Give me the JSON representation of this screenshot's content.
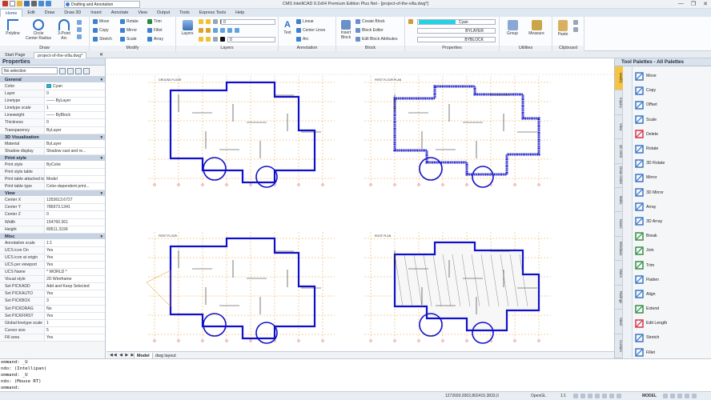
{
  "title_bar": {
    "workspace": "Drafting and Annotation",
    "title": "CMS IntelliCAD 9.2x64 Premium Edition Plus Net - [project-of-the-villa.dwg*]",
    "window_buttons": [
      "—",
      "❐",
      "✕"
    ]
  },
  "menu": [
    "Home",
    "Edit",
    "Draw",
    "Draw 3D",
    "Insert",
    "Annotate",
    "View",
    "Output",
    "Tools",
    "Express Tools",
    "Help"
  ],
  "ribbon": {
    "groups": [
      {
        "name": "Draw"
      },
      {
        "name": "Modify"
      },
      {
        "name": "Layers"
      },
      {
        "name": "Annotation"
      },
      {
        "name": "Block"
      },
      {
        "name": "Properties"
      },
      {
        "name": "Utilities"
      },
      {
        "name": "Clipboard"
      }
    ],
    "draw": {
      "polyline": "Polyline",
      "circle": "Circle",
      "circle_sub": "Center Radius",
      "arc": "3-Point",
      "arc_sub": "Arc"
    },
    "modify": {
      "move": "Move",
      "rotate": "Rotate",
      "trim": "Trim",
      "copy": "Copy",
      "mirror": "Mirror",
      "fillet": "Fillet",
      "stretch": "Stretch",
      "scale": "Scale",
      "array": "Array"
    },
    "layers": {
      "layers_btn": "Layers",
      "current_layer": "0",
      "layer2": "0"
    },
    "annotation": {
      "text": "Text",
      "linear": "Linear",
      "centerlines": "Center Lines",
      "arc": "Arc"
    },
    "block": {
      "insert": "Insert",
      "insert_sub": "Block",
      "create": "Create Block",
      "editor": "Block Editor",
      "edit_attrs": "Edit Block Attributes"
    },
    "properties": {
      "color": "Cyan",
      "linetype": "BYLAYER",
      "lineweight": "BYBLOCK"
    },
    "utilities": {
      "group": "Group",
      "measure": "Measure"
    },
    "clipboard": {
      "paste": "Paste"
    }
  },
  "doc_tabs": [
    "Start Page",
    "project-of-the-villa.dwg*"
  ],
  "properties_panel": {
    "title": "Properties",
    "selection": "No selection",
    "sections": [
      {
        "name": "General",
        "rows": [
          {
            "k": "Color",
            "v": "Cyan"
          },
          {
            "k": "Layer",
            "v": "0"
          },
          {
            "k": "Linetype",
            "v": "—— ByLayer"
          },
          {
            "k": "Linetype scale",
            "v": "1"
          },
          {
            "k": "Lineweight",
            "v": "—— ByBlock"
          },
          {
            "k": "Thickness",
            "v": "0"
          },
          {
            "k": "Transparency",
            "v": "ByLayer"
          }
        ]
      },
      {
        "name": "3D Visualization",
        "rows": [
          {
            "k": "Material",
            "v": "ByLayer"
          },
          {
            "k": "Shadow display",
            "v": "Shadow cast and re..."
          }
        ]
      },
      {
        "name": "Print style",
        "rows": [
          {
            "k": "Print style",
            "v": "ByColor"
          },
          {
            "k": "Print style table",
            "v": ""
          },
          {
            "k": "Print table attached to",
            "v": "Model"
          },
          {
            "k": "Print table type",
            "v": "Color-dependent print..."
          }
        ]
      },
      {
        "name": "View",
        "rows": [
          {
            "k": "Center X",
            "v": "1253613.6727"
          },
          {
            "k": "Center Y",
            "v": "786973.1341"
          },
          {
            "k": "Center Z",
            "v": "0"
          },
          {
            "k": "Width",
            "v": "154760.361"
          },
          {
            "k": "Height",
            "v": "89511.3199"
          }
        ]
      },
      {
        "name": "Misc",
        "rows": [
          {
            "k": "Annotation scale",
            "v": "1:1"
          },
          {
            "k": "UCS icon On",
            "v": "Yes"
          },
          {
            "k": "UCS icon at origin",
            "v": "Yes"
          },
          {
            "k": "UCS per viewport",
            "v": "Yes"
          },
          {
            "k": "UCS Name",
            "v": "* WORLD *"
          },
          {
            "k": "Visual style",
            "v": "2D Wireframe"
          },
          {
            "k": "Set PICKADD",
            "v": "Add and Keep Selected"
          },
          {
            "k": "Set PICKAUTO",
            "v": "Yes"
          },
          {
            "k": "Set PICKBOX",
            "v": "3"
          },
          {
            "k": "Set PICKDRAG",
            "v": "No"
          },
          {
            "k": "Set PICKFIRST",
            "v": "Yes"
          },
          {
            "k": "Global linetype scale",
            "v": "1"
          },
          {
            "k": "Cursor size",
            "v": "5"
          },
          {
            "k": "Fill area",
            "v": "Yes"
          }
        ]
      }
    ]
  },
  "canvas_tabs": {
    "model": "Model",
    "layout": "dwg layout"
  },
  "tool_palette": {
    "title": "Tool Palettes - All Palettes",
    "vertical_tabs": [
      "Modify",
      "Inquiry",
      "View",
      "3D Orbit",
      "Draw Order",
      "Walls",
      "Doors",
      "Windows",
      "Stairs",
      "Railings",
      "Steel",
      "Custom"
    ],
    "items": [
      {
        "label": "Move",
        "icon": "move-icon",
        "color": "#2f6fc4"
      },
      {
        "label": "Copy",
        "icon": "copy-icon",
        "color": "#2f6fc4"
      },
      {
        "label": "Offset",
        "icon": "offset-icon",
        "color": "#2f6fc4"
      },
      {
        "label": "Scale",
        "icon": "scale-icon",
        "color": "#2f6fc4"
      },
      {
        "label": "Delete",
        "icon": "delete-icon",
        "color": "#d7263d"
      },
      {
        "label": "Rotate",
        "icon": "rotate-icon",
        "color": "#2f6fc4"
      },
      {
        "label": "3D Rotate",
        "icon": "3d-rotate-icon",
        "color": "#2f6fc4"
      },
      {
        "label": "Mirror",
        "icon": "mirror-icon",
        "color": "#2f6fc4"
      },
      {
        "label": "3D Mirror",
        "icon": "3d-mirror-icon",
        "color": "#2f6fc4"
      },
      {
        "label": "Array",
        "icon": "array-icon",
        "color": "#2f6fc4"
      },
      {
        "label": "3D Array",
        "icon": "3d-array-icon",
        "color": "#2f6fc4"
      },
      {
        "label": "Break",
        "icon": "break-icon",
        "color": "#2a8a3b"
      },
      {
        "label": "Join",
        "icon": "join-icon",
        "color": "#2a8a3b"
      },
      {
        "label": "Trim",
        "icon": "trim-icon",
        "color": "#2a8a3b"
      },
      {
        "label": "Flatten",
        "icon": "flatten-icon",
        "color": "#2f6fc4"
      },
      {
        "label": "Align",
        "icon": "align-icon",
        "color": "#2f6fc4"
      },
      {
        "label": "Extend",
        "icon": "extend-icon",
        "color": "#2a8a3b"
      },
      {
        "label": "Edit Length",
        "icon": "edit-length-icon",
        "color": "#d7263d"
      },
      {
        "label": "Stretch",
        "icon": "stretch-icon",
        "color": "#2f6fc4"
      },
      {
        "label": "Fillet",
        "icon": "fillet-icon",
        "color": "#2f6fc4"
      }
    ]
  },
  "command_line": [
    "ommand: _U",
    "ndo: (Intellipan)",
    "ommand: _U",
    "ndo: (Mouse RT)",
    "ommand:"
  ],
  "status_bar": {
    "coords": "1272693.9302,802415.3833,0",
    "opengl": "OpenGL",
    "scale": "1:1",
    "model": "MODEL"
  },
  "sheets": [
    {
      "label": "GROUND FLOOR"
    },
    {
      "label": "FIRST FLOOR PLAN"
    },
    {
      "label": "FIRST FLOOR"
    },
    {
      "label": "ROOF PLAN"
    }
  ],
  "colors": {
    "wall": "#1010c8",
    "hatch": "#5555d8",
    "dim": "#e28a17",
    "grid": "#d62828",
    "cyan": "#22b8d8"
  }
}
